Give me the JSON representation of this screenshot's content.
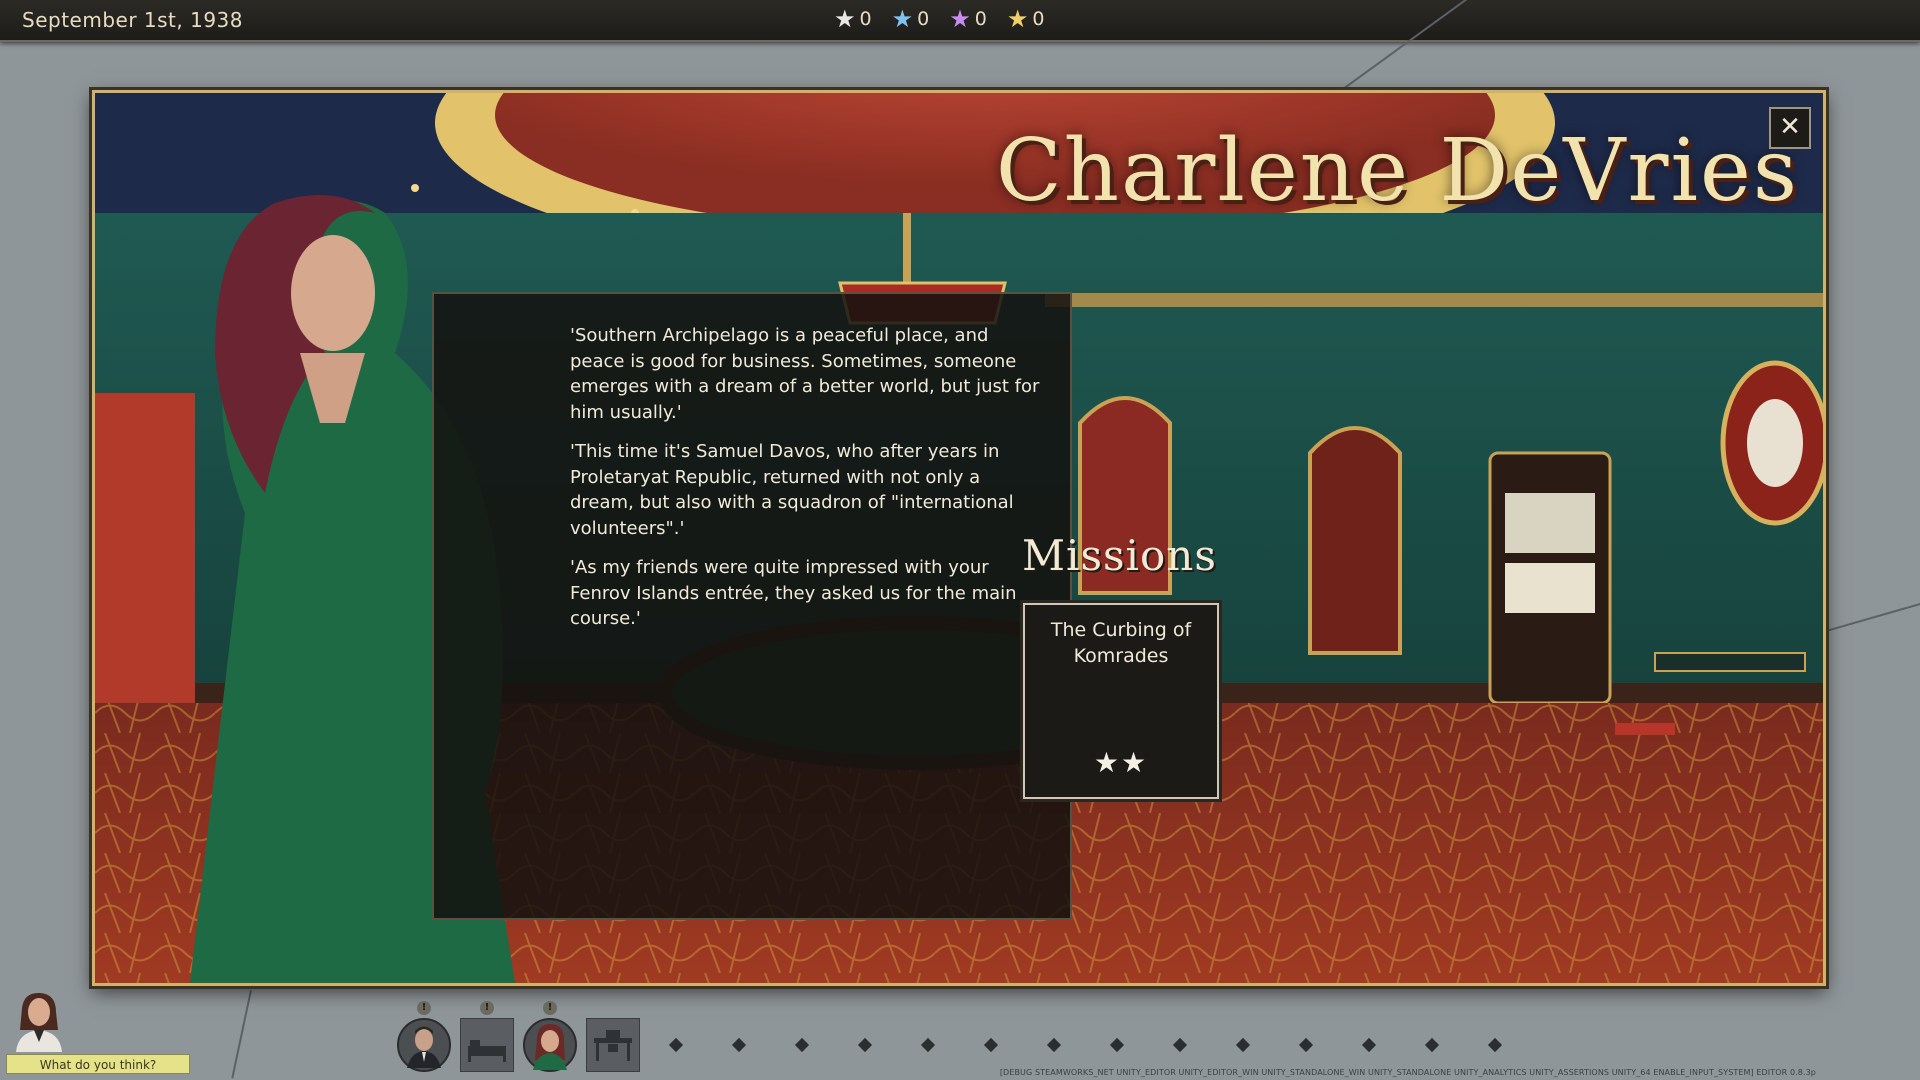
{
  "top_bar": {
    "date": "September 1st, 1938",
    "star_counters": [
      {
        "icon": "white-star-icon",
        "color": "#e8e8e8",
        "count": "0"
      },
      {
        "icon": "blue-star-icon",
        "color": "#7ec3f0",
        "count": "0"
      },
      {
        "icon": "purple-star-icon",
        "color": "#c98cf0",
        "count": "0"
      },
      {
        "icon": "gold-star-icon",
        "color": "#f0cf6b",
        "count": "0"
      }
    ]
  },
  "dialog": {
    "title": "Charlene DeVries",
    "close_icon": "close-icon",
    "story": [
      "'Southern Archipelago is a peaceful place, and peace is good for business. Sometimes, someone emerges with a dream of a better world, but just for him usually.'",
      "'This time it's Samuel Davos, who after years in Proletaryat Republic, returned with not only a dream, but also with a squadron of \"international volunteers\".'",
      "'As my friends were quite impressed with your Fenrov Islands entrée, they asked us for the main course.'"
    ],
    "missions_heading": "Missions",
    "missions": [
      {
        "title": "The Curbing of Komrades",
        "stars": "★★"
      }
    ]
  },
  "dock": {
    "advisor_prompt": "What do you think?",
    "badge": "!",
    "slots": [
      "portrait-man-icon",
      "bed-icon",
      "portrait-woman-icon",
      "desk-icon"
    ]
  },
  "debug_text": "[DEBUG STEAMWORKS_NET UNITY_EDITOR UNITY_EDITOR_WIN UNITY_STANDALONE_WIN UNITY_STANDALONE UNITY_ANALYTICS UNITY_ASSERTIONS UNITY_64 ENABLE_INPUT_SYSTEM] EDITOR 0.8.3p"
}
